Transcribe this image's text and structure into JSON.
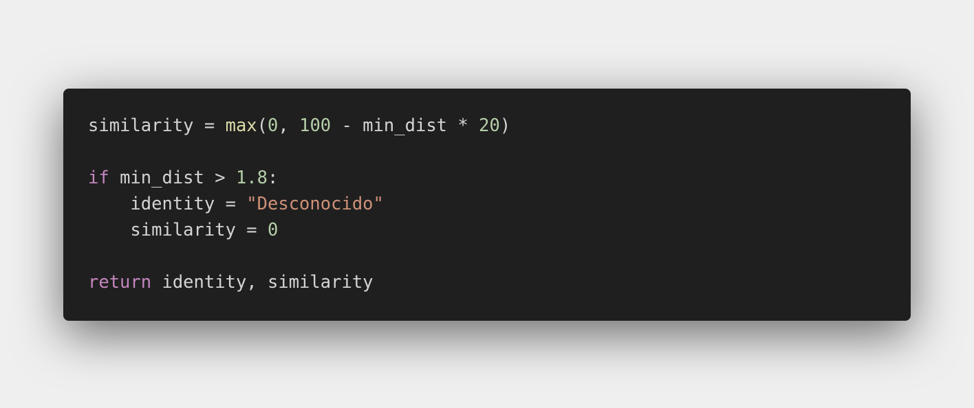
{
  "colors": {
    "background": "#efefef",
    "card": "#1f1f1f",
    "text": "#d4d4d4",
    "keyword": "#c586c0",
    "function": "#dcdcaa",
    "number": "#b5cea8",
    "string": "#ce9178"
  },
  "code": {
    "lines": [
      [
        {
          "t": "similarity = ",
          "k": "text"
        },
        {
          "t": "max",
          "k": "function"
        },
        {
          "t": "(",
          "k": "text"
        },
        {
          "t": "0",
          "k": "number"
        },
        {
          "t": ", ",
          "k": "text"
        },
        {
          "t": "100",
          "k": "number"
        },
        {
          "t": " - min_dist * ",
          "k": "text"
        },
        {
          "t": "20",
          "k": "number"
        },
        {
          "t": ")",
          "k": "text"
        }
      ],
      [],
      [
        {
          "t": "if",
          "k": "keyword"
        },
        {
          "t": " min_dist > ",
          "k": "text"
        },
        {
          "t": "1.8",
          "k": "number"
        },
        {
          "t": ":",
          "k": "text"
        }
      ],
      [
        {
          "t": "    identity = ",
          "k": "text"
        },
        {
          "t": "\"Desconocido\"",
          "k": "string"
        }
      ],
      [
        {
          "t": "    similarity = ",
          "k": "text"
        },
        {
          "t": "0",
          "k": "number"
        }
      ],
      [],
      [
        {
          "t": "return",
          "k": "keyword"
        },
        {
          "t": " identity, similarity",
          "k": "text"
        }
      ]
    ]
  }
}
